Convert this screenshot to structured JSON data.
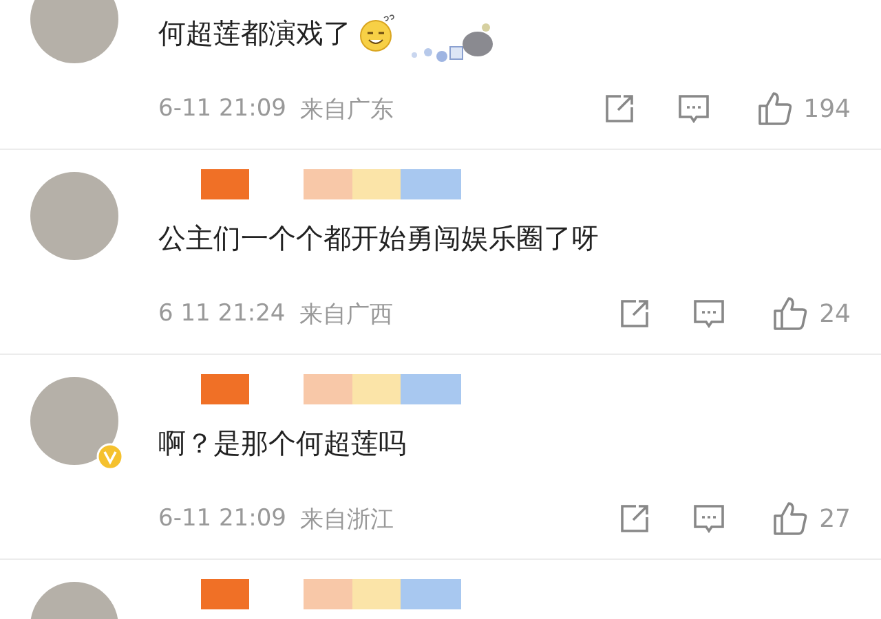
{
  "comments": [
    {
      "verified": false,
      "text": "何超莲都演戏了",
      "has_emoji": true,
      "time": "6-11 21:09",
      "location": "来自广东",
      "likes": "194"
    },
    {
      "name_obscured": true,
      "verified": false,
      "text": "公主们一个个都开始勇闯娱乐圈了呀",
      "has_emoji": false,
      "time": "6 11 21:24",
      "location": "来自广西",
      "likes": "24"
    },
    {
      "name_obscured": true,
      "verified": true,
      "text": "啊？是那个何超莲吗",
      "has_emoji": false,
      "time": "6-11 21:09",
      "location": "来自浙江",
      "likes": "27"
    },
    {
      "name_obscured": true,
      "verified": false
    }
  ]
}
